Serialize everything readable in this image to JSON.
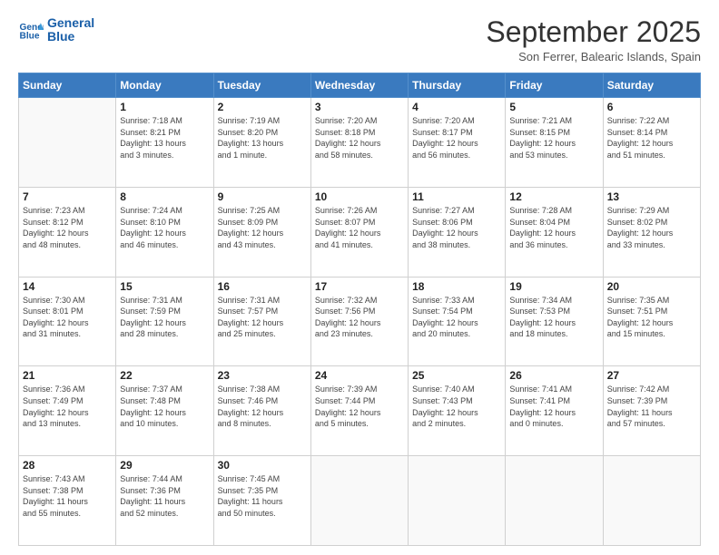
{
  "header": {
    "logo_line1": "General",
    "logo_line2": "Blue",
    "month": "September 2025",
    "location": "Son Ferrer, Balearic Islands, Spain"
  },
  "days_of_week": [
    "Sunday",
    "Monday",
    "Tuesday",
    "Wednesday",
    "Thursday",
    "Friday",
    "Saturday"
  ],
  "weeks": [
    [
      {
        "day": "",
        "info": ""
      },
      {
        "day": "1",
        "info": "Sunrise: 7:18 AM\nSunset: 8:21 PM\nDaylight: 13 hours\nand 3 minutes."
      },
      {
        "day": "2",
        "info": "Sunrise: 7:19 AM\nSunset: 8:20 PM\nDaylight: 13 hours\nand 1 minute."
      },
      {
        "day": "3",
        "info": "Sunrise: 7:20 AM\nSunset: 8:18 PM\nDaylight: 12 hours\nand 58 minutes."
      },
      {
        "day": "4",
        "info": "Sunrise: 7:20 AM\nSunset: 8:17 PM\nDaylight: 12 hours\nand 56 minutes."
      },
      {
        "day": "5",
        "info": "Sunrise: 7:21 AM\nSunset: 8:15 PM\nDaylight: 12 hours\nand 53 minutes."
      },
      {
        "day": "6",
        "info": "Sunrise: 7:22 AM\nSunset: 8:14 PM\nDaylight: 12 hours\nand 51 minutes."
      }
    ],
    [
      {
        "day": "7",
        "info": "Sunrise: 7:23 AM\nSunset: 8:12 PM\nDaylight: 12 hours\nand 48 minutes."
      },
      {
        "day": "8",
        "info": "Sunrise: 7:24 AM\nSunset: 8:10 PM\nDaylight: 12 hours\nand 46 minutes."
      },
      {
        "day": "9",
        "info": "Sunrise: 7:25 AM\nSunset: 8:09 PM\nDaylight: 12 hours\nand 43 minutes."
      },
      {
        "day": "10",
        "info": "Sunrise: 7:26 AM\nSunset: 8:07 PM\nDaylight: 12 hours\nand 41 minutes."
      },
      {
        "day": "11",
        "info": "Sunrise: 7:27 AM\nSunset: 8:06 PM\nDaylight: 12 hours\nand 38 minutes."
      },
      {
        "day": "12",
        "info": "Sunrise: 7:28 AM\nSunset: 8:04 PM\nDaylight: 12 hours\nand 36 minutes."
      },
      {
        "day": "13",
        "info": "Sunrise: 7:29 AM\nSunset: 8:02 PM\nDaylight: 12 hours\nand 33 minutes."
      }
    ],
    [
      {
        "day": "14",
        "info": "Sunrise: 7:30 AM\nSunset: 8:01 PM\nDaylight: 12 hours\nand 31 minutes."
      },
      {
        "day": "15",
        "info": "Sunrise: 7:31 AM\nSunset: 7:59 PM\nDaylight: 12 hours\nand 28 minutes."
      },
      {
        "day": "16",
        "info": "Sunrise: 7:31 AM\nSunset: 7:57 PM\nDaylight: 12 hours\nand 25 minutes."
      },
      {
        "day": "17",
        "info": "Sunrise: 7:32 AM\nSunset: 7:56 PM\nDaylight: 12 hours\nand 23 minutes."
      },
      {
        "day": "18",
        "info": "Sunrise: 7:33 AM\nSunset: 7:54 PM\nDaylight: 12 hours\nand 20 minutes."
      },
      {
        "day": "19",
        "info": "Sunrise: 7:34 AM\nSunset: 7:53 PM\nDaylight: 12 hours\nand 18 minutes."
      },
      {
        "day": "20",
        "info": "Sunrise: 7:35 AM\nSunset: 7:51 PM\nDaylight: 12 hours\nand 15 minutes."
      }
    ],
    [
      {
        "day": "21",
        "info": "Sunrise: 7:36 AM\nSunset: 7:49 PM\nDaylight: 12 hours\nand 13 minutes."
      },
      {
        "day": "22",
        "info": "Sunrise: 7:37 AM\nSunset: 7:48 PM\nDaylight: 12 hours\nand 10 minutes."
      },
      {
        "day": "23",
        "info": "Sunrise: 7:38 AM\nSunset: 7:46 PM\nDaylight: 12 hours\nand 8 minutes."
      },
      {
        "day": "24",
        "info": "Sunrise: 7:39 AM\nSunset: 7:44 PM\nDaylight: 12 hours\nand 5 minutes."
      },
      {
        "day": "25",
        "info": "Sunrise: 7:40 AM\nSunset: 7:43 PM\nDaylight: 12 hours\nand 2 minutes."
      },
      {
        "day": "26",
        "info": "Sunrise: 7:41 AM\nSunset: 7:41 PM\nDaylight: 12 hours\nand 0 minutes."
      },
      {
        "day": "27",
        "info": "Sunrise: 7:42 AM\nSunset: 7:39 PM\nDaylight: 11 hours\nand 57 minutes."
      }
    ],
    [
      {
        "day": "28",
        "info": "Sunrise: 7:43 AM\nSunset: 7:38 PM\nDaylight: 11 hours\nand 55 minutes."
      },
      {
        "day": "29",
        "info": "Sunrise: 7:44 AM\nSunset: 7:36 PM\nDaylight: 11 hours\nand 52 minutes."
      },
      {
        "day": "30",
        "info": "Sunrise: 7:45 AM\nSunset: 7:35 PM\nDaylight: 11 hours\nand 50 minutes."
      },
      {
        "day": "",
        "info": ""
      },
      {
        "day": "",
        "info": ""
      },
      {
        "day": "",
        "info": ""
      },
      {
        "day": "",
        "info": ""
      }
    ]
  ]
}
